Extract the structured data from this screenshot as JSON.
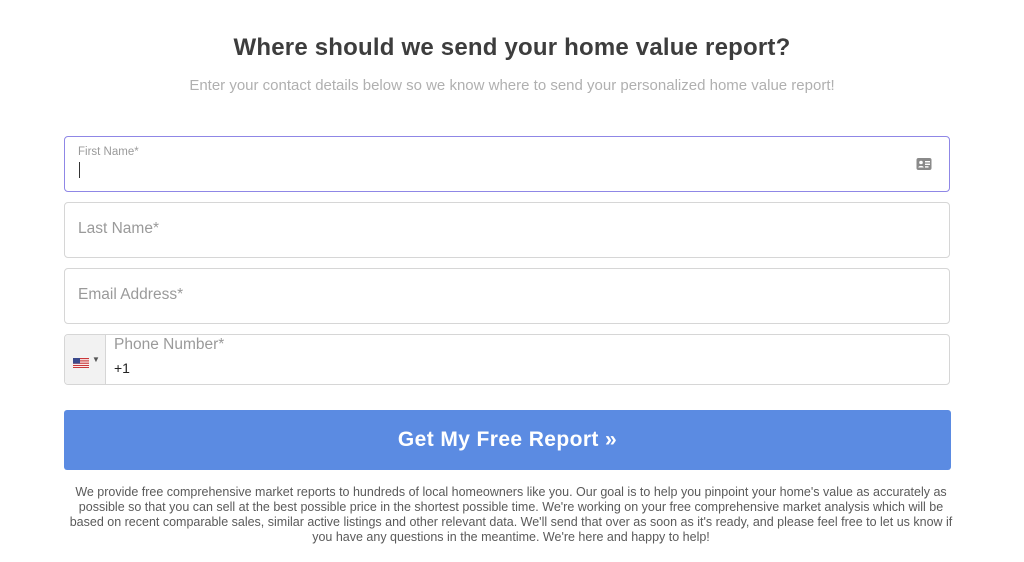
{
  "form": {
    "title": "Where should we send your home value report?",
    "subtitle": "Enter your contact details below so we know where to send your personalized home value report!",
    "first_name": {
      "label": "First Name*",
      "value": "",
      "icon": "contact-card-icon"
    },
    "last_name": {
      "placeholder": "Last Name*",
      "value": ""
    },
    "email": {
      "placeholder": "Email Address*",
      "value": ""
    },
    "phone": {
      "label": "Phone Number*",
      "value": "+1",
      "country_flag": "us-flag-icon"
    },
    "submit_label": "Get My Free Report »",
    "disclaimer": "We provide free comprehensive market reports to hundreds of local homeowners like you. Our goal is to help you pinpoint your home's value as accurately as possible so that you can sell at the best possible price in the shortest possible time. We're working on your free comprehensive market analysis which will be based on recent comparable sales, similar active listings and other relevant data. We'll send that over as soon as it's ready, and please feel free to let us know if you have any questions in the meantime. We're here and happy to help!"
  },
  "colors": {
    "accent": "#5b8be2",
    "focus_border": "#8f87e6",
    "title": "#3d3d3d",
    "subtitle": "#b0b0b0"
  }
}
